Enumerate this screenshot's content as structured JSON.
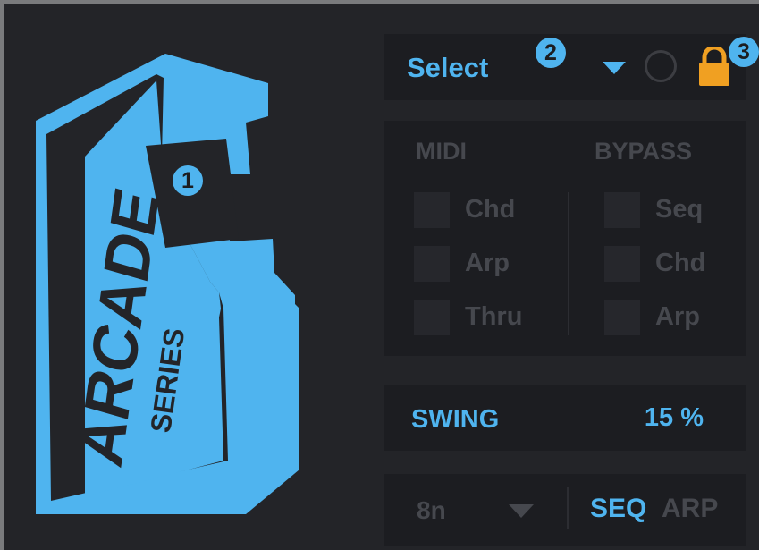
{
  "logo": {
    "line1": "ARCADE",
    "line2": "SERIES"
  },
  "header": {
    "select_label": "Select"
  },
  "badges": [
    "1",
    "2",
    "3"
  ],
  "midi": {
    "title": "MIDI",
    "items": [
      {
        "label": "Chd"
      },
      {
        "label": "Arp"
      },
      {
        "label": "Thru"
      }
    ]
  },
  "bypass": {
    "title": "BYPASS",
    "items": [
      {
        "label": "Seq"
      },
      {
        "label": "Chd"
      },
      {
        "label": "Arp"
      }
    ]
  },
  "swing": {
    "label": "SWING",
    "value": "15 %"
  },
  "bottom": {
    "note": "8n",
    "seq": "SEQ",
    "arp": "ARP"
  },
  "colors": {
    "accent": "#4fb4ef",
    "lock": "#f0a022",
    "panel": "#1c1d21",
    "bg": "#232428",
    "dim": "#46484e"
  }
}
